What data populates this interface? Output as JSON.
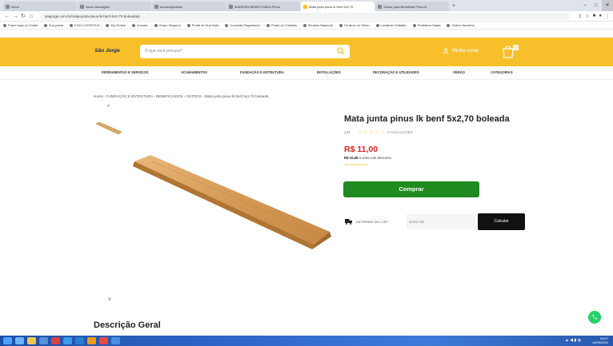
{
  "browser": {
    "tabs": [
      {
        "label": "Inbox",
        "active": false
      },
      {
        "label": "Nova mensagem",
        "active": false
      },
      {
        "label": "acesso/pedidos",
        "active": false
      },
      {
        "label": "MADEIRA BENEFICIADA Pinus",
        "active": false
      },
      {
        "label": "Mata junta pinus lk benf 5x2,70",
        "active": true
      },
      {
        "label": "Vidros para Beneficiar Pinus lk",
        "active": false
      }
    ],
    "new_tab": "+",
    "url": "saojorge.com.br/mata-junta-pinus-lk-benf-5x2-70-boleada/p",
    "bookmarks": [
      "Fazer login no Gmail",
      "Sua pasta",
      "CGO LOGISTICA",
      "My Orders",
      "Inovare",
      "Grupo Seguros",
      "Portal do Sua Nota",
      "Consulta Pagamento",
      "Portal do Cidadão",
      "Simples Nacional",
      "Os itens do Ofício",
      "Localizar Cidadão",
      "Prefeitura Santa",
      "Outros favoritos"
    ]
  },
  "header": {
    "logo_text": "São Jorge",
    "search_placeholder": "O que você procura?",
    "account_label": "Minha conta",
    "cart_count": "0"
  },
  "menu": {
    "items": [
      "FERRAMENTAS E SERVIÇOS",
      "ACABAMENTOS",
      "FUNDAÇÃO E ESTRUTURA",
      "INSTALAÇÕES",
      "DECORAÇÃO E UTILIDADES",
      "VERÃO",
      "CATEGORIAS"
    ]
  },
  "breadcrumb": "Home  ›  FUNDAÇÃO E ESTRUTURA  ›  BENEFICIADOS  ›  OUTROS  ›  Mata junta pinus lk benf 5x2,70 boleada",
  "gallery": {
    "up_arrow": "^",
    "down_arrow": "˅"
  },
  "product": {
    "title": "Mata junta pinus lk benf 5x2,70 boleada",
    "code": "124",
    "stars": "☆☆☆☆☆",
    "reviews": "0 AVALIAÇÕES",
    "price": "R$ 11,00",
    "pix_price": "R$ 10,45",
    "pix_text": "à vista com desconto",
    "installments": "Ver parcelamento",
    "buy_label": "Comprar"
  },
  "shipping": {
    "label": "INFORMAR SEU CEP",
    "cep_placeholder": "00000-000",
    "calc_label": "Calcular"
  },
  "description": {
    "title": "Descrição Geral"
  },
  "taskbar": {
    "time": "09:07",
    "date": "16/05/2024"
  },
  "colors": {
    "brand_yellow": "#f7c02a",
    "buy_green": "#1f8a1f",
    "price_red": "#e02020"
  }
}
